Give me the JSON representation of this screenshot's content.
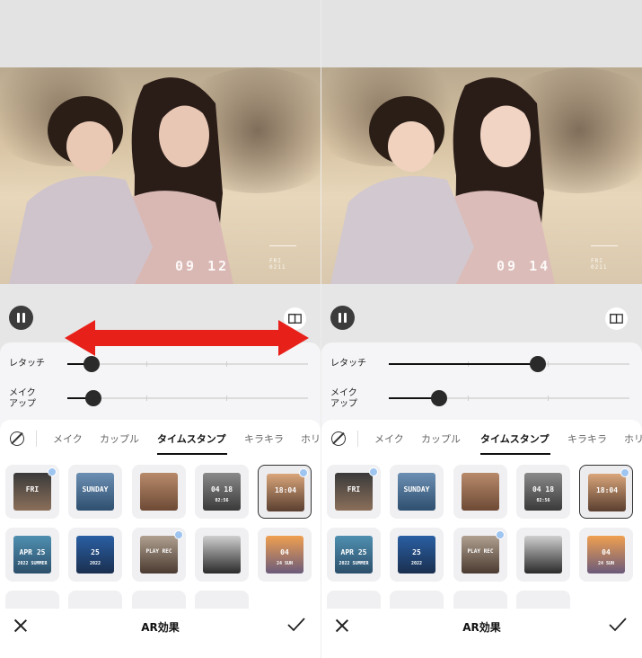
{
  "panels": [
    {
      "clock": {
        "time": "09 12",
        "day": "FRI",
        "date": "0211"
      },
      "sliders": [
        {
          "label_line1": "レタッチ",
          "label_line2": "",
          "value": 0.1
        },
        {
          "label_line1": "メイク",
          "label_line2": "アップ",
          "value": 0.11
        }
      ]
    },
    {
      "clock": {
        "time": "09 14",
        "day": "FRI",
        "date": "0211"
      },
      "sliders": [
        {
          "label_line1": "レタッチ",
          "label_line2": "",
          "value": 0.62
        },
        {
          "label_line1": "メイク",
          "label_line2": "アップ",
          "value": 0.21
        }
      ]
    }
  ],
  "tabs": [
    "メイク",
    "カップル",
    "タイムスタンプ",
    "キラキラ",
    "ホリ"
  ],
  "active_tab_index": 2,
  "stamps": [
    {
      "text1": "FRI",
      "text2": "",
      "colors": [
        "#3a3a3a",
        "#8b6f5a"
      ]
    },
    {
      "text1": "SUNDAY",
      "text2": "",
      "colors": [
        "#6b8fb3",
        "#2f4f6f"
      ]
    },
    {
      "text1": "",
      "text2": "",
      "colors": [
        "#b88a6a",
        "#6d4a36"
      ]
    },
    {
      "text1": "04 18",
      "text2": "02:56",
      "colors": [
        "#8a8a8a",
        "#3a3a3a"
      ]
    },
    {
      "text1": "18:04",
      "text2": "",
      "colors": [
        "#d9a57a",
        "#5a3f30"
      ]
    },
    {
      "text1": "APR 25",
      "text2": "2022 SUMMER",
      "colors": [
        "#4f8fb0",
        "#2c4f6b"
      ]
    },
    {
      "text1": "25",
      "text2": "2022",
      "colors": [
        "#2a5fa3",
        "#1a2f4f"
      ]
    },
    {
      "text1": "PLAY REC",
      "text2": "",
      "colors": [
        "#b0a090",
        "#4a3a30"
      ]
    },
    {
      "text1": "",
      "text2": "",
      "colors": [
        "#cfcfcf",
        "#2a2a2a"
      ]
    },
    {
      "text1": "04",
      "text2": "24 SUN",
      "colors": [
        "#f0a050",
        "#6a5a7a"
      ]
    }
  ],
  "bottom": {
    "title": "AR効果"
  },
  "colors": {
    "arrow": "#e8201a",
    "accent": "#111111"
  }
}
